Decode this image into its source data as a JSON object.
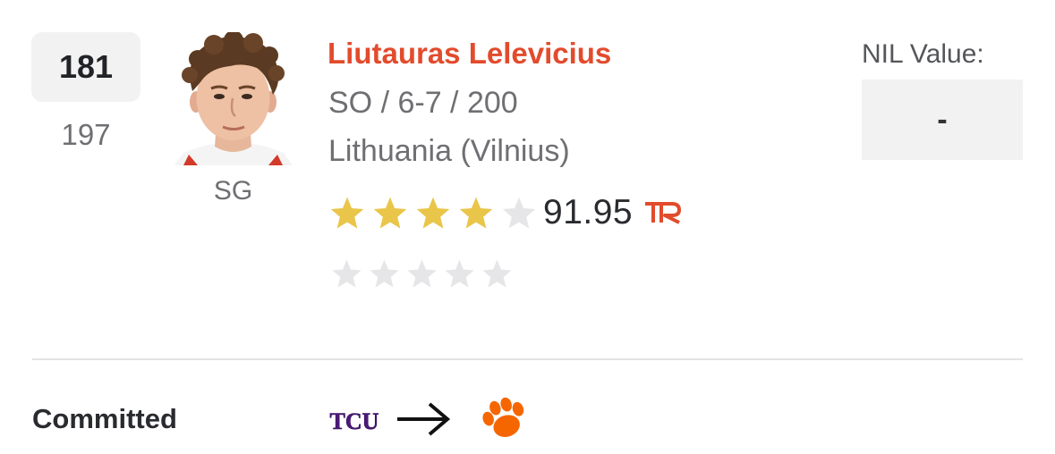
{
  "player": {
    "rank": "181",
    "previous_rank": "197",
    "position": "SG",
    "name": "Liutauras Lelevicius",
    "meta": "SO / 6-7 / 200",
    "hometown": "Lithuania (Vilnius)",
    "stars": 4,
    "max_stars": 5,
    "rating": "91.95",
    "rating_source_icon": "tr-logo",
    "second_rating_stars": 0
  },
  "nil": {
    "label": "NIL Value:",
    "value": "-"
  },
  "status": {
    "label": "Committed",
    "from_school_logo": "TCU",
    "to_school_icon": "clemson-paw-icon",
    "arrow_icon": "right-arrow-icon"
  },
  "colors": {
    "name": "#e24b2c",
    "star_filled": "#e9c549",
    "star_empty": "#e6e6e8",
    "tcu_purple": "#4d1979",
    "clemson_orange": "#f56600"
  }
}
